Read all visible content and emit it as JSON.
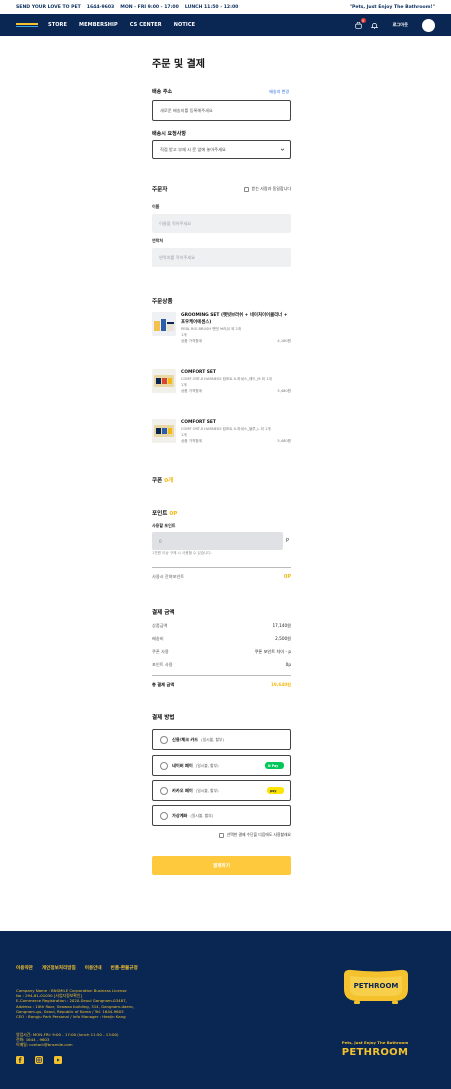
{
  "topbar": {
    "tagline": "SEND YOUR LOVE TO PET",
    "phone": "1644-9603",
    "hours": "MON - FRI 9:00 - 17:00",
    "lunch": "LUNCH 11:50 - 12:00",
    "slogan": "\"Pets, Just Enjoy The Bathroom!\""
  },
  "nav": {
    "links": [
      "STORE",
      "MEMBERSHIP",
      "CS CENTER",
      "NOTICE"
    ],
    "cart_count": "0",
    "login": "로그아웃"
  },
  "page": {
    "title": "주문 및 결제"
  },
  "shipping": {
    "label": "배송 주소",
    "change_link": "배송지 변경",
    "address_placeholder": "새로운 배송지를 등록해주세요",
    "request_label": "배송시 요청사항",
    "request_value": "직접 받고 부재 시 문 앞에 놓아주세요"
  },
  "orderer": {
    "title": "주문자",
    "same_as_recipient": "받는 사람과 동일합니다",
    "name_label": "이름",
    "name_placeholder": "이름을 적어주세요",
    "phone_label": "연락처",
    "phone_placeholder": "연락처를 적어주세요"
  },
  "products": {
    "title": "주문상품",
    "items": [
      {
        "name": "GROOMING SET (펫빗브러쉬 + 네이처이어클리너 + 포우케어에센스)",
        "option": "PEBL RIG BRUSH 펫빗 브러쉬 외 2개",
        "qty": "1개",
        "price_label": "상품 가격합계",
        "price": "4,180원"
      },
      {
        "name": "COMFORT SET",
        "option": "COMF ORT-X HARNESS 컴포트 X-하네스_레드_M 외 1개",
        "qty": "1개",
        "price_label": "상품 가격합계",
        "price": "5,480원"
      },
      {
        "name": "COMFORT SET",
        "option": "COMF ORT-X HARNESS 컴포트 X-하네스_블루_L 외 1개",
        "qty": "1개",
        "price_label": "상품 가격합계",
        "price": "5,480원"
      }
    ]
  },
  "coupon": {
    "label": "쿠폰",
    "value": "0개"
  },
  "points": {
    "label": "포인트",
    "value": "0P",
    "use_label": "사용할 포인트",
    "input_placeholder": "0",
    "unit": "P",
    "hint": "1천원 이상 구매 시 사용할 수 있습니다.",
    "remaining_label": "사용시 잔여포인트",
    "remaining_value": "0P"
  },
  "summary": {
    "title": "결제 금액",
    "rows": [
      {
        "label": "상품금액",
        "value": "17,140원"
      },
      {
        "label": "배송비",
        "value": "2,500원"
      },
      {
        "label": "쿠폰 사용",
        "value": "쿠폰 포인트 차이 - p"
      },
      {
        "label": "포인트 사용",
        "value": "0p"
      }
    ],
    "total_label": "총 결제 금액",
    "total_value": "19,640원"
  },
  "payment": {
    "title": "결제 방법",
    "options": [
      {
        "name": "신용/체크 카드",
        "desc": "(일시불, 할부)",
        "badge": ""
      },
      {
        "name": "네이버 페이",
        "desc": "(일시불, 할부)",
        "badge": "N Pay"
      },
      {
        "name": "카카오 페이",
        "desc": "(일시불, 할부)",
        "badge": "pay"
      },
      {
        "name": "가상계좌",
        "desc": "(일시불, 할부)",
        "badge": ""
      }
    ],
    "save_method": "선택한 결제 수단을 다음에도 사용할래요",
    "submit": "결제하기"
  },
  "footer": {
    "links": [
      "이용약관",
      "개인정보처리방침",
      "이용안내",
      "반품·환불규정"
    ],
    "company": [
      "Company Name : BNSMILE Corporation Business License",
      "No : 294-81-01030 [사업자정보확인]",
      "E-Commerce Registration : 2020-Seoul Gangnam-03487,",
      "Address : 10th floor, Seawoo building, 314, Gangnam-daero,",
      "Gangnam-gu, Seoul, Republic of Korea / Tel. 1644-9603",
      "CEO : Bangju Park Personal / Info Manager : Heejin Kang"
    ],
    "hours": [
      "영업시간: MON-FRI: 9:00 - 17:00 (lunch 11:50 - 13:00)",
      "전화: 1644 - 9603",
      "이메일: contact@bnsmile.com"
    ],
    "social_icons": [
      "facebook-icon",
      "instagram-icon",
      "youtube-icon"
    ],
    "logo_badge": "PETHROOM",
    "tagline": "Pets, Just Enjoy The Bathroom",
    "brand": "PETHROOM"
  },
  "colors": {
    "navy": "#0a2753",
    "accent_yellow": "#f5b913",
    "button_yellow": "#fec93c",
    "naver_green": "#03c75a",
    "kakao_yellow": "#fee500",
    "link_blue": "#2b6fd6"
  }
}
